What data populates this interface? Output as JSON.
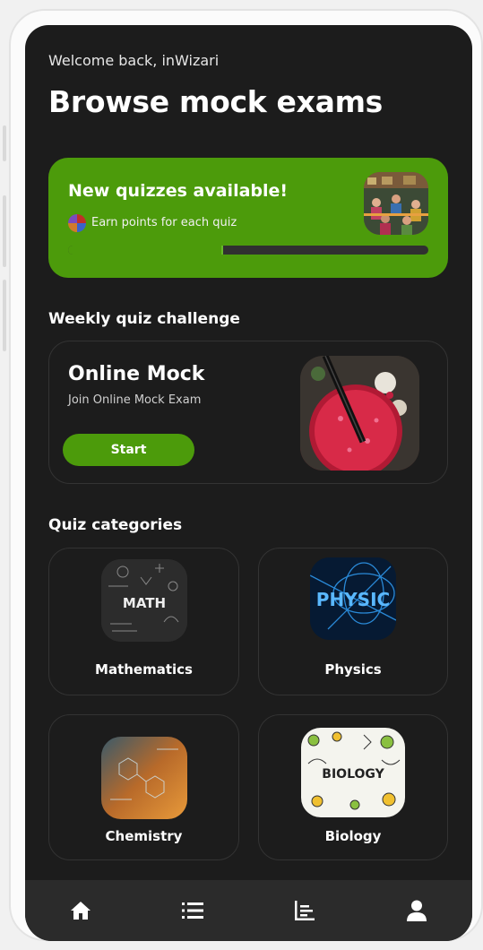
{
  "greeting": "Welcome back, inWizari",
  "page_title": "Browse mock exams",
  "banner": {
    "title": "New quizzes available!",
    "subtitle": "Earn points for each quiz",
    "progress": 0.43,
    "bg_color": "#4c9b0b"
  },
  "weekly": {
    "heading": "Weekly quiz challenge",
    "card_title": "Online Mock",
    "card_subtitle": "Join Online Mock Exam",
    "start_label": "Start"
  },
  "categories_heading": "Quiz categories",
  "categories": [
    {
      "label": "Mathematics",
      "icon_text": "MATH"
    },
    {
      "label": "Physics",
      "icon_text": "PHYSIC"
    },
    {
      "label": "Chemistry",
      "icon_text": ""
    },
    {
      "label": "Biology",
      "icon_text": "BIOLOGY"
    }
  ],
  "nav": [
    {
      "icon": "home-icon"
    },
    {
      "icon": "list-icon"
    },
    {
      "icon": "leaderboard-icon"
    },
    {
      "icon": "profile-icon"
    }
  ],
  "colors": {
    "accent": "#4c9b0b",
    "screen_bg": "#1c1c1c",
    "nav_bg": "#2b2b2b"
  }
}
